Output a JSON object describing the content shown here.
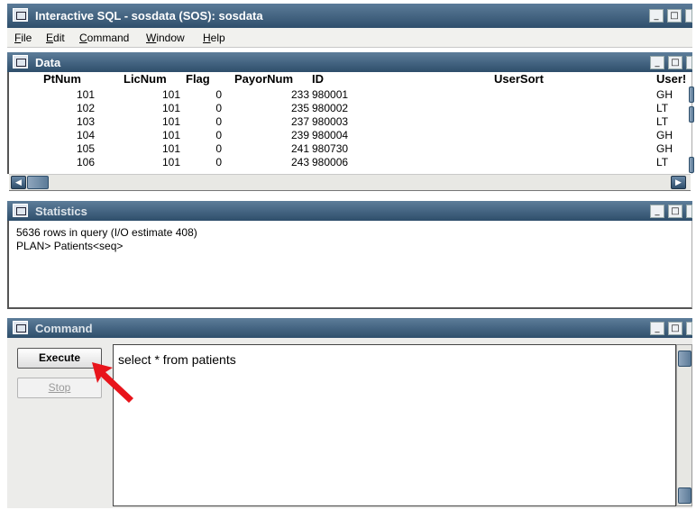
{
  "window": {
    "title": "Interactive SQL - sosdata (SOS): sosdata"
  },
  "menu": [
    "File",
    "Edit",
    "Command",
    "Window",
    "Help"
  ],
  "data_pane": {
    "title": "Data",
    "columns": [
      "PtNum",
      "LicNum",
      "Flag",
      "PayorNum",
      "ID",
      "UserSort",
      "User!"
    ],
    "rows": [
      [
        "101",
        "101",
        "0",
        "233",
        "980001",
        "",
        "GH"
      ],
      [
        "102",
        "101",
        "0",
        "235",
        "980002",
        "",
        "LT"
      ],
      [
        "103",
        "101",
        "0",
        "237",
        "980003",
        "",
        "LT"
      ],
      [
        "104",
        "101",
        "0",
        "239",
        "980004",
        "",
        "GH"
      ],
      [
        "105",
        "101",
        "0",
        "241",
        "980730",
        "",
        "GH"
      ],
      [
        "106",
        "101",
        "0",
        "243",
        "980006",
        "",
        "LT"
      ]
    ]
  },
  "statistics_pane": {
    "title": "Statistics",
    "lines": [
      "5636 rows in query (I/O estimate 408)",
      "PLAN> Patients<seq>"
    ]
  },
  "command_pane": {
    "title": "Command",
    "execute_label": "Execute",
    "stop_label": "Stop",
    "query_text": "select * from patients"
  },
  "colors": {
    "titlebar": "#2f4f6c",
    "arrow": "#e8141b"
  },
  "icons": [
    "window-menu-icon",
    "minimize-icon",
    "maximize-icon",
    "close-icon",
    "scroll-left-icon",
    "scroll-right-icon",
    "red-arrow-icon"
  ]
}
